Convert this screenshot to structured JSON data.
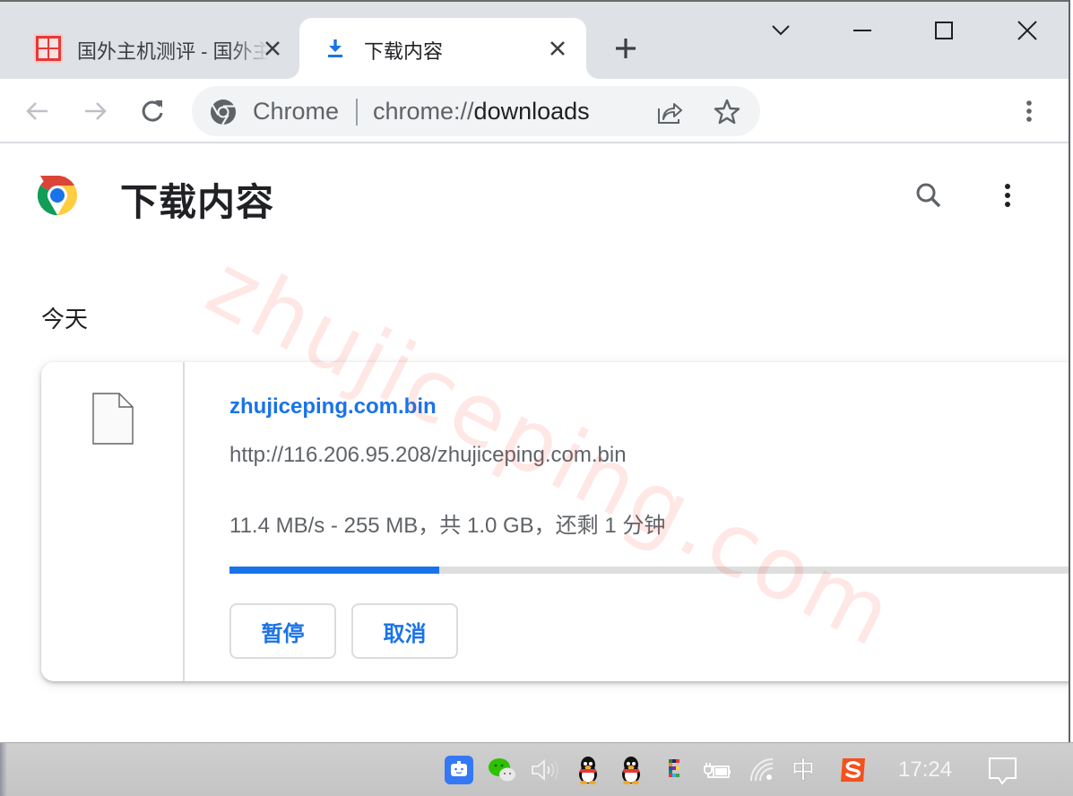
{
  "tabs": [
    {
      "title": "国外主机测评 - 国外主机测评",
      "favicon": "site-favicon-red",
      "active": false,
      "close_icon": "close-icon"
    },
    {
      "title": "下载内容",
      "favicon": "download-icon",
      "active": true,
      "close_icon": "close-icon"
    }
  ],
  "tabstrip": {
    "new_tab_icon": "plus-icon",
    "tab_search_icon": "chevron-down-icon"
  },
  "window_controls": {
    "minimize_icon": "minimize-icon",
    "maximize_icon": "maximize-icon",
    "close_icon": "close-icon"
  },
  "toolbar": {
    "back_icon": "arrow-left-icon",
    "forward_icon": "arrow-right-icon",
    "reload_icon": "reload-icon",
    "omnibox": {
      "site_label": "Chrome",
      "url_scheme": "chrome://",
      "url_host": "downloads",
      "share_icon": "share-icon",
      "bookmark_icon": "star-icon"
    },
    "menu_icon": "more-vertical-icon"
  },
  "page": {
    "title": "下载内容",
    "search_icon": "search-icon",
    "menu_icon": "more-vertical-icon",
    "section_label": "今天",
    "watermark": "zhujiceping.com",
    "downloads": [
      {
        "file_name": "zhujiceping.com.bin",
        "url": "http://116.206.95.208/zhujiceping.com.bin",
        "status": "11.4 MB/s - 255 MB，共 1.0 GB，还剩 1 分钟",
        "progress_percent": 25,
        "buttons": {
          "pause": "暂停",
          "cancel": "取消"
        }
      }
    ]
  },
  "taskbar": {
    "tray_icons": [
      "assistant-icon",
      "wechat-icon",
      "volume-icon",
      "qq-icon",
      "qq-icon",
      "color-grid-app-icon",
      "power-plug-battery-icon",
      "wifi-icon",
      "ime-chinese-icon",
      "sogou-input-icon"
    ],
    "ime_label": "中",
    "clock": "17:24",
    "notification_icon": "notification-icon"
  },
  "colors": {
    "accent": "#1a73e8",
    "tabstrip_bg": "#dee1e6",
    "omnibox_bg": "#f1f3f4",
    "progress_track": "#dedede",
    "taskbar_bg": "#c9c9c9",
    "watermark": "#f44336"
  }
}
